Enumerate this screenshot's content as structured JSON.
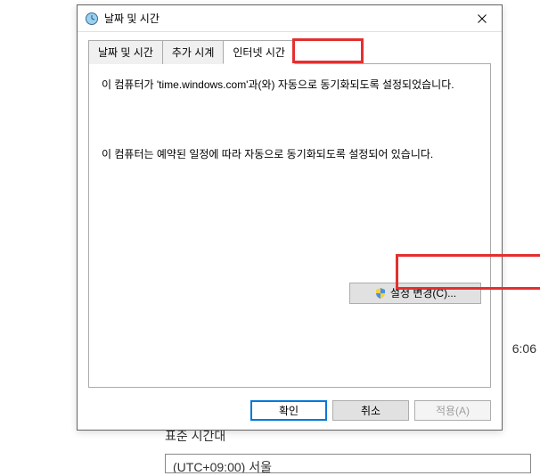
{
  "dialog": {
    "title": "날짜 및 시간",
    "tabs": {
      "datetime": "날짜 및 시간",
      "additional_clocks": "추가 시계",
      "internet_time": "인터넷 시간"
    },
    "content": {
      "sync_status": "이 컴퓨터가 'time.windows.com'과(와) 자동으로 동기화되도록 설정되었습니다.",
      "schedule_info": "이 컴퓨터는 예약된 일정에 따라 자동으로 동기화되도록 설정되어 있습니다.",
      "change_settings_label": "설정 변경(C)..."
    },
    "buttons": {
      "ok": "확인",
      "cancel": "취소",
      "apply": "적용(A)"
    }
  },
  "background": {
    "time_fragment": "6:06",
    "timezone_section_title": "표준 시간대",
    "timezone_value": "(UTC+09:00) 서울"
  }
}
